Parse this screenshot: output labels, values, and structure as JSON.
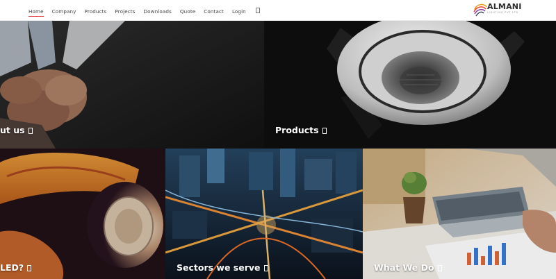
{
  "nav": {
    "items": [
      "Home",
      "Company",
      "Products",
      "Projects",
      "Downloads",
      "Quote",
      "Contact",
      "Login"
    ],
    "active": "Home",
    "search_icon": "search-icon"
  },
  "logo": {
    "name": "ALMANI",
    "subtitle": "LIGHTING PVT LTD"
  },
  "tiles": {
    "about": "ut us",
    "products": "Products",
    "led": "LED?",
    "sectors": "Sectors we serve",
    "whatwedo": "What We Do"
  },
  "colors": {
    "accent": "#d8262c",
    "nav_text": "#444444",
    "tile_text": "#ffffff"
  }
}
